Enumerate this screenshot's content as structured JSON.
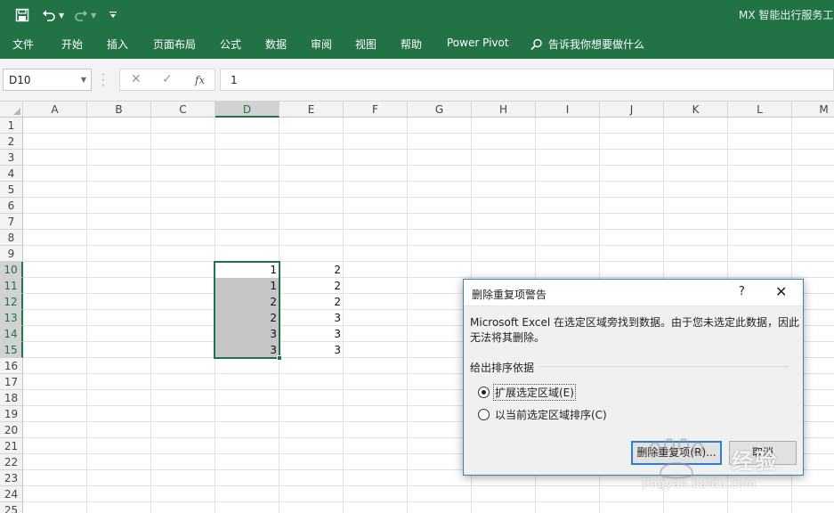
{
  "window": {
    "title": "MX 智能出行服务工作"
  },
  "qat": {
    "save_icon": "save-icon",
    "undo_icon": "undo-icon",
    "redo_icon": "redo-icon",
    "customize_icon": "customize-icon"
  },
  "ribbon": {
    "tabs": [
      "文件",
      "开始",
      "插入",
      "页面布局",
      "公式",
      "数据",
      "审阅",
      "视图",
      "帮助",
      "Power Pivot"
    ],
    "tell_me": "告诉我你想要做什么"
  },
  "formula_bar": {
    "name_box": "D10",
    "cancel_glyph": "✕",
    "enter_glyph": "✓",
    "fx_label": "fx",
    "value": "1"
  },
  "grid": {
    "columns": [
      "A",
      "B",
      "C",
      "D",
      "E",
      "F",
      "G",
      "H",
      "I",
      "J",
      "K",
      "L",
      "M"
    ],
    "rows": [
      "1",
      "2",
      "3",
      "4",
      "5",
      "6",
      "7",
      "8",
      "9",
      "10",
      "11",
      "12",
      "13",
      "14",
      "15",
      "16",
      "17",
      "18",
      "19",
      "20",
      "21",
      "22",
      "23",
      "24",
      "25"
    ],
    "selected_column": "D",
    "selected_rows": [
      "10",
      "11",
      "12",
      "13",
      "14",
      "15"
    ],
    "cells": [
      {
        "ref": "D10",
        "value": "1"
      },
      {
        "ref": "E10",
        "value": "2"
      },
      {
        "ref": "D11",
        "value": "1"
      },
      {
        "ref": "E11",
        "value": "2"
      },
      {
        "ref": "D12",
        "value": "2"
      },
      {
        "ref": "E12",
        "value": "2"
      },
      {
        "ref": "D13",
        "value": "2"
      },
      {
        "ref": "E13",
        "value": "3"
      },
      {
        "ref": "D14",
        "value": "3"
      },
      {
        "ref": "E14",
        "value": "3"
      },
      {
        "ref": "D15",
        "value": "3"
      },
      {
        "ref": "E15",
        "value": "3"
      }
    ]
  },
  "dialog": {
    "title": "删除重复项警告",
    "help": "?",
    "close": "✕",
    "message": "Microsoft Excel 在选定区域旁找到数据。由于您未选定此数据，因此无法将其删除。",
    "group_label": "给出排序依据",
    "option_expand": "扩展选定区域(E)",
    "option_current": "以当前选定区域排序(C)",
    "selected_option": "expand",
    "ok_button": "删除重复项(R)...",
    "cancel_button": "取消"
  },
  "watermark": {
    "brand": "经验",
    "url": "jingyan.baidu.com"
  }
}
